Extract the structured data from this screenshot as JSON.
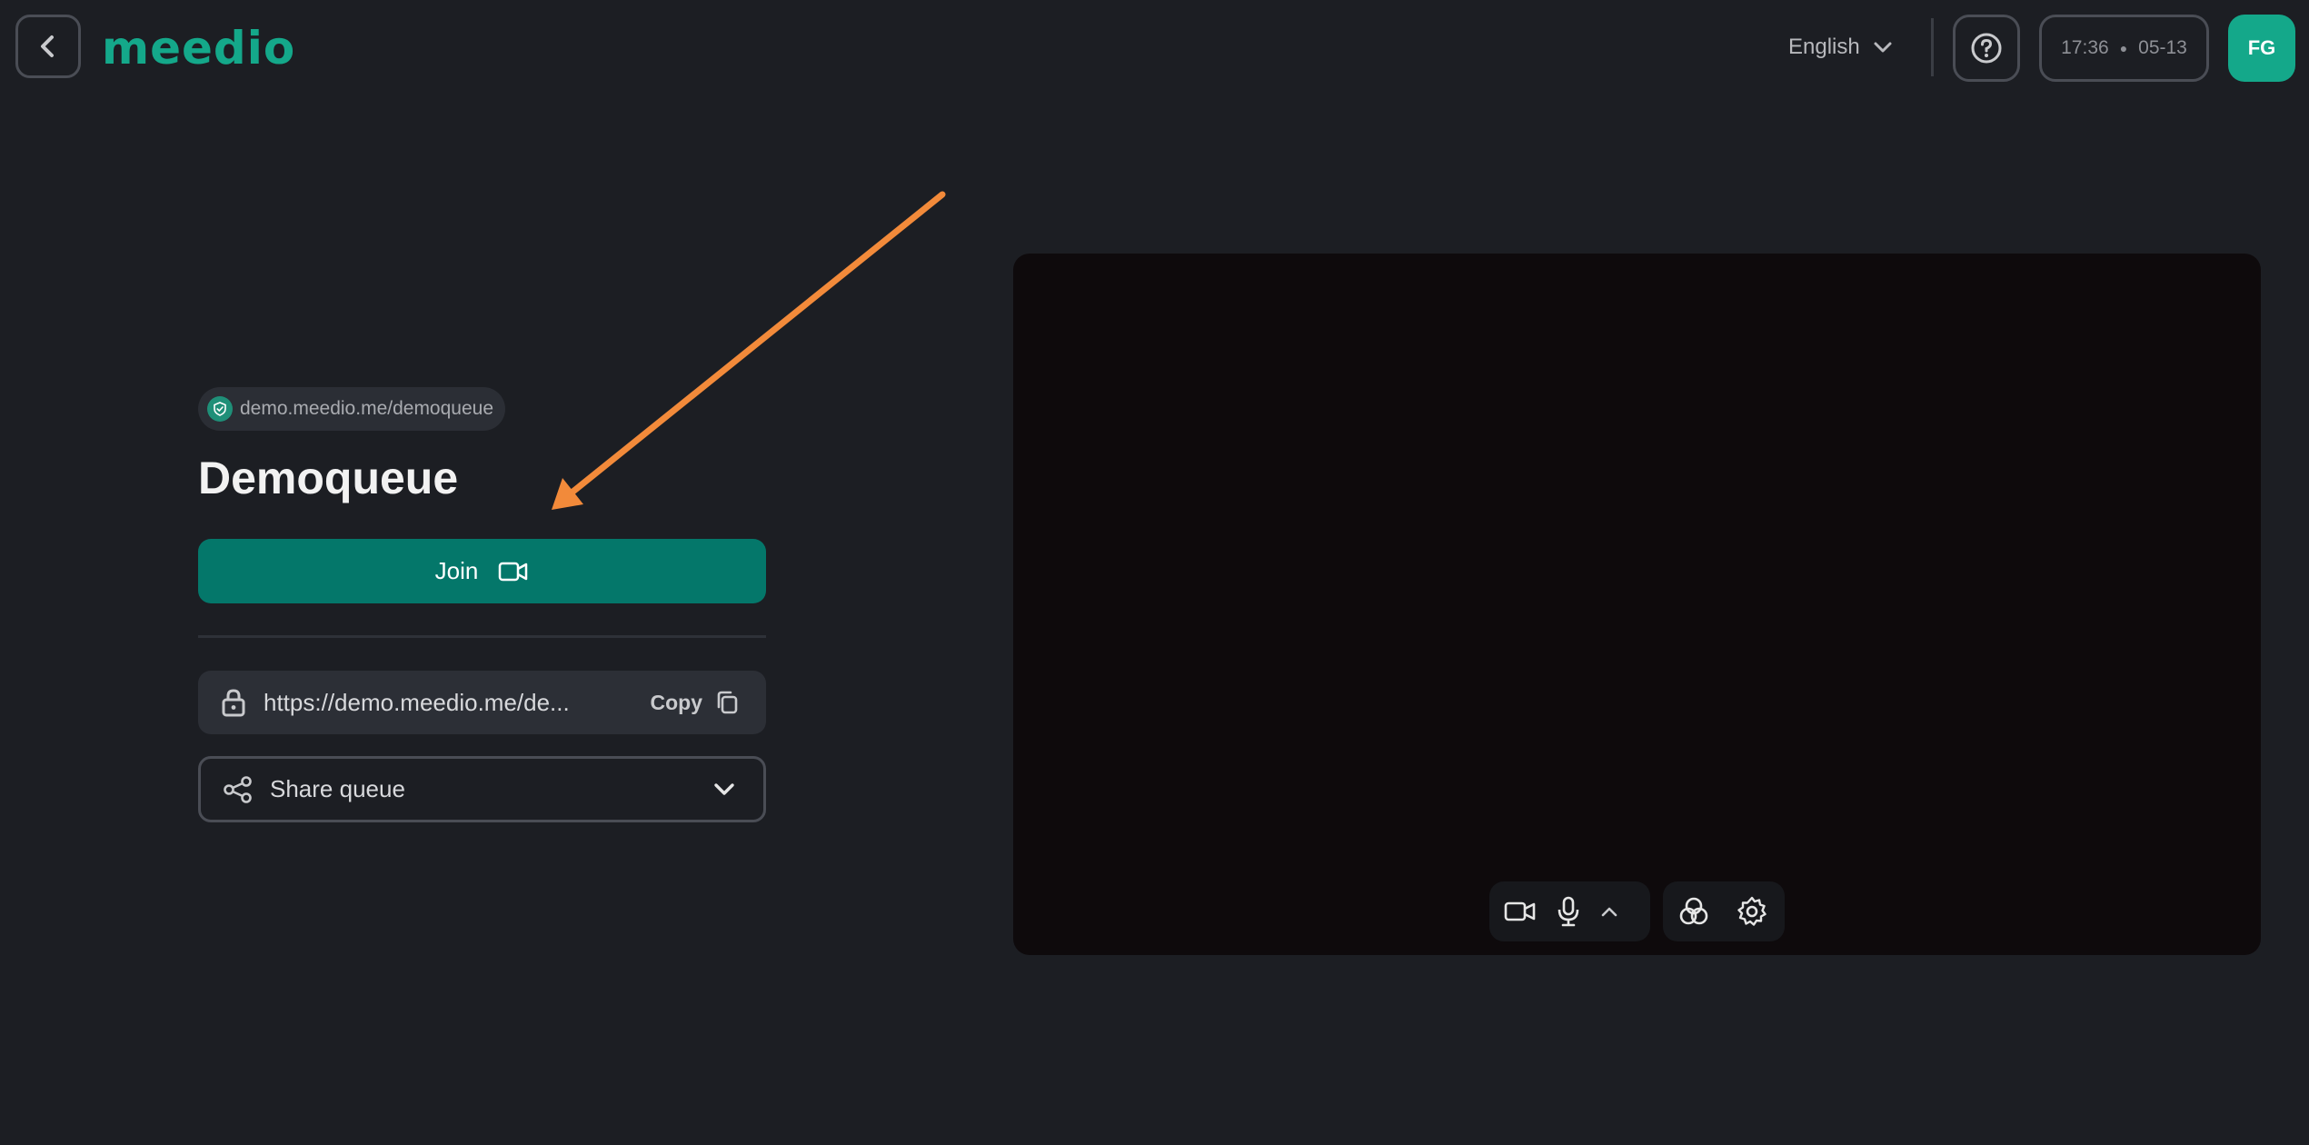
{
  "header": {
    "back_label": "",
    "logo_text": "meedio",
    "language": "English",
    "time": "17:36",
    "date": "05-13",
    "avatar_initials": "FG"
  },
  "queue": {
    "domain": "demo.meedio.me/demoqueue",
    "title": "Demoqueue",
    "join_label": "Join",
    "link_value": "https://demo.meedio.me/de...",
    "copy_label": "Copy",
    "share_label": "Share queue"
  },
  "video_controls": {
    "icons": [
      "camera-icon",
      "microphone-icon",
      "chevron-up-icon",
      "effects-icon",
      "settings-icon"
    ]
  },
  "colors": {
    "background": "#1c1e23",
    "brand": "#14a88a",
    "join_button": "#04776a",
    "annotation_arrow": "#f28a3a"
  }
}
